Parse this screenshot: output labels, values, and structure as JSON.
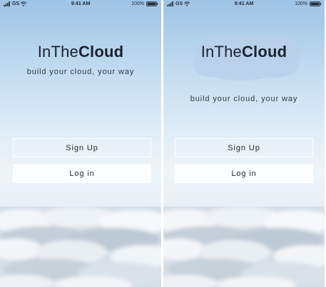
{
  "status_bar": {
    "carrier": "GS",
    "time": "9:41 AM",
    "battery": "100%",
    "icons": [
      "signal-icon",
      "wifi-icon",
      "battery-icon"
    ]
  },
  "screens": [
    {
      "brand_light": "InThe",
      "brand_bold": "Cloud",
      "tagline": "build your cloud, your way",
      "signup_label": "Sign Up",
      "login_label": "Log in"
    },
    {
      "brand_light": "InThe",
      "brand_bold": "Cloud",
      "tagline": "build your cloud, your way",
      "signup_label": "Sign Up",
      "login_label": "Log in"
    }
  ],
  "colors": {
    "sky_top": "#9fc3e4",
    "sky_mid": "#e2eef7",
    "cloud_blob": "#b9cfe9",
    "text": "#1b232d",
    "button_outline": "#ffffff",
    "button_fill": "#ffffff"
  }
}
